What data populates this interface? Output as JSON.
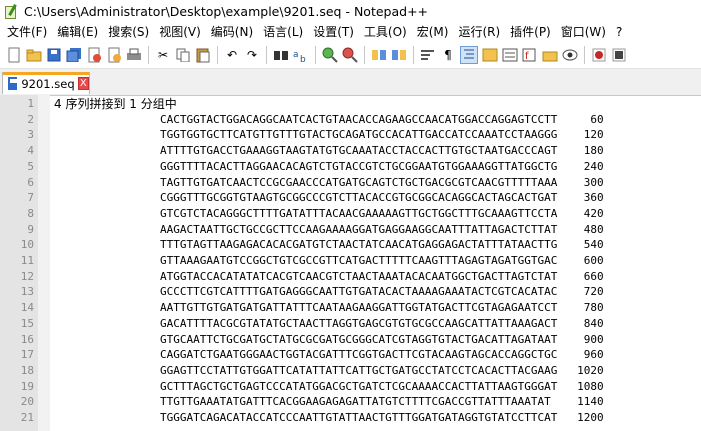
{
  "window": {
    "title": "C:\\Users\\Administrator\\Desktop\\example\\9201.seq - Notepad++"
  },
  "menu": [
    "文件(F)",
    "编辑(E)",
    "搜索(S)",
    "视图(V)",
    "编码(N)",
    "语言(L)",
    "设置(T)",
    "工具(O)",
    "宏(M)",
    "运行(R)",
    "插件(P)",
    "窗口(W)",
    "?"
  ],
  "toolbar": {
    "icons": [
      "new-file-icon",
      "open-file-icon",
      "save-icon",
      "save-all-icon",
      "close-icon",
      "close-all-icon",
      "print-icon",
      "cut-icon",
      "copy-icon",
      "paste-icon",
      "undo-icon",
      "redo-icon",
      "find-icon",
      "replace-icon",
      "zoom-in-icon",
      "zoom-out-icon",
      "sync-scroll-icon",
      "wrap-icon",
      "show-all-chars-icon",
      "indent-guide-icon",
      "doc-map-icon",
      "function-list-icon",
      "folder-icon",
      "monitoring-icon",
      "record-macro-icon",
      "stop-record-icon"
    ]
  },
  "tab": {
    "label": "9201.seq",
    "close": "X"
  },
  "editor": {
    "lines": [
      {
        "n": "1",
        "text": "4 序列拼接到 1 分组中",
        "header": true
      },
      {
        "n": "2",
        "text": "                CACTGGTACTGGACAGGCAATCACTGTAACACCAGAAGCCAACATGGACCAGGAGTCCTT     60"
      },
      {
        "n": "3",
        "text": "                TGGTGGTGCTTCATGTTGTTTGTACTGCAGATGCCACATTGACCATCCAAATCCTAAGGG    120"
      },
      {
        "n": "4",
        "text": "                ATTTTGTGACCTGAAAGGTAAGTATGTGCAAATACCTACCACTTGTGCTAATGACCCAGT    180"
      },
      {
        "n": "5",
        "text": "                GGGTTTTACACTTAGGAACACAGTCTGTACCGTCTGCGGAATGTGGAAAGGTTATGGCTG    240"
      },
      {
        "n": "6",
        "text": "                TAGTTGTGATCAACTCCGCGAACCCATGATGCAGTCTGCTGACGCGTCAACGTTTTTAAA    300"
      },
      {
        "n": "7",
        "text": "                CGGGTTTGCGGTGTAAGTGCGGCCCGTCTTACACCGTGCGGCACAGGCACTAGCACTGAT    360"
      },
      {
        "n": "8",
        "text": "                GTCGTCTACAGGGCTTTTGATATTTACAACGAAAAAGTTGCTGGCTTTGCAAAGTTCCTA    420"
      },
      {
        "n": "9",
        "text": "                AAGACTAATTGCTGCCGCTTCCAAGAAAAGGATGAGGAAGGCAATTTATTAGACTCTTAT    480"
      },
      {
        "n": "10",
        "text": "                TTTGTAGTTAAGAGACACACGATGTCTAACTATCAACATGAGGAGACTATTTATAACTTG    540"
      },
      {
        "n": "11",
        "text": "                GTTAAAGAATGTCCGGCTGTCGCCGTTCATGACTTTTTCAAGTTTAGAGTAGATGGTGAC    600"
      },
      {
        "n": "12",
        "text": "                ATGGTACCACATATATCACGTCAACGTCTAACTAAATACACAATGGCTGACTTAGTCTAT    660"
      },
      {
        "n": "13",
        "text": "                GCCCTTCGTCATTTTGATGAGGGCAATTGTGATACACTAAAAGAAATACTCGTCACATAC    720"
      },
      {
        "n": "14",
        "text": "                AATTGTTGTGATGATGATTATTTCAATAAGAAGGATTGGTATGACTTCGTAGAGAATCCT    780"
      },
      {
        "n": "15",
        "text": "                GACATTTTACGCGTATATGCTAACTTAGGTGAGCGTGTGCGCCAAGCATTATTAAAGACT    840"
      },
      {
        "n": "16",
        "text": "                GTGCAATTCTGCGATGCTATGCGCGATGCGGGCATCGTAGGTGTACTGACATTAGATAAT    900"
      },
      {
        "n": "17",
        "text": "                CAGGATCTGAATGGGAACTGGTACGATTTCGGTGACTTCGTACAAGTAGCACCAGGCTGC    960"
      },
      {
        "n": "18",
        "text": "                GGAGTTCCTATTGTGGATTCATATTATTCATTGCTGATGCCTATCCTCACACTTACGAAG   1020"
      },
      {
        "n": "19",
        "text": "                GCTTTAGCTGCTGAGTCCCATATGGACGCTGATCTCGCAAAACCACTTATTAAGTGGGAT   1080"
      },
      {
        "n": "20",
        "text": "                TTGTTGAAATATGATTTCACGGAAGAGAGATTATGTCTTTTCGACCGTTATTTAAATAT    1140"
      },
      {
        "n": "21",
        "text": "                TGGGATCAGACATACCATCCCAATTGTATTAACTGTTTGGATGATAGGTGTATCCTTCAT   1200"
      }
    ]
  }
}
